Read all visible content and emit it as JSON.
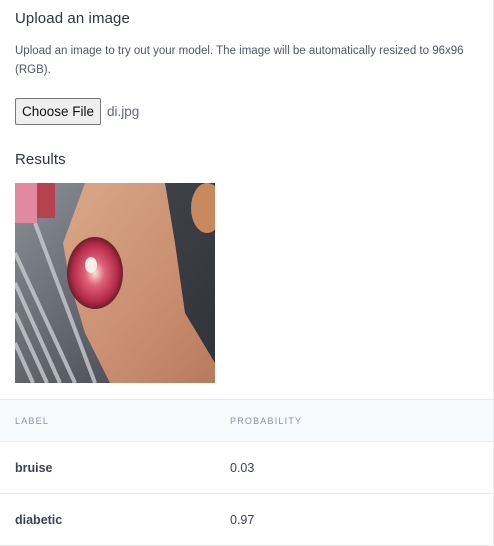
{
  "upload": {
    "title": "Upload an image",
    "description": "Upload an image to try out your model. The image will be automatically resized to 96x96 (RGB).",
    "choose_button_label": "Choose File",
    "file_name": "di.jpg"
  },
  "results": {
    "title": "Results",
    "table": {
      "columns": [
        "LABEL",
        "PROBABILITY"
      ],
      "rows": [
        {
          "label": "bruise",
          "probability": "0.03"
        },
        {
          "label": "diabetic",
          "probability": "0.97"
        }
      ]
    }
  }
}
